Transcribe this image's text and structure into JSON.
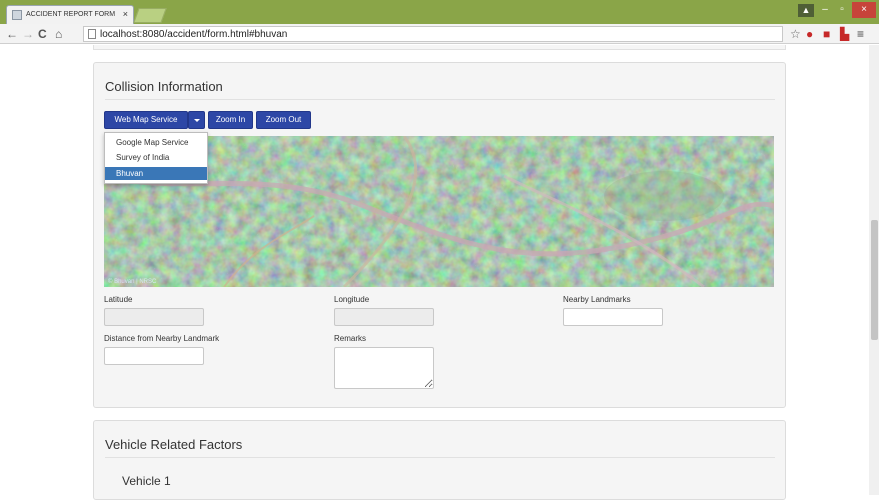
{
  "browser": {
    "tab_title": "ACCIDENT REPORT FORM",
    "tab_close": "×",
    "url": "localhost:8080/accident/form.html#bhuvan",
    "window_user": "▲",
    "minimize": "–",
    "maximize": "▫",
    "close": "×"
  },
  "collision": {
    "title": "Collision Information",
    "map_service_button": "Web Map Service",
    "zoom_in": "Zoom In",
    "zoom_out": "Zoom Out",
    "map_service_options": [
      "Google Map Service",
      "Survey of India",
      "Bhuvan"
    ],
    "map_service_selected": "Bhuvan",
    "map_attribution": "© Bhuvan | NRSC"
  },
  "fields": {
    "latitude_label": "Latitude",
    "latitude_value": "",
    "longitude_label": "Longitude",
    "longitude_value": "",
    "landmarks_label": "Nearby Landmarks",
    "landmarks_value": "",
    "distance_label": "Distance from Nearby Landmark",
    "distance_value": "",
    "remarks_label": "Remarks",
    "remarks_value": ""
  },
  "vehicle": {
    "title": "Vehicle Related Factors",
    "vehicle1_title": "Vehicle 1"
  },
  "colors": {
    "button_primary": "#2d47a6",
    "dropdown_active": "#3a77b7",
    "panel_bg": "#f5f5f5",
    "titlebar": "#8aa548"
  }
}
